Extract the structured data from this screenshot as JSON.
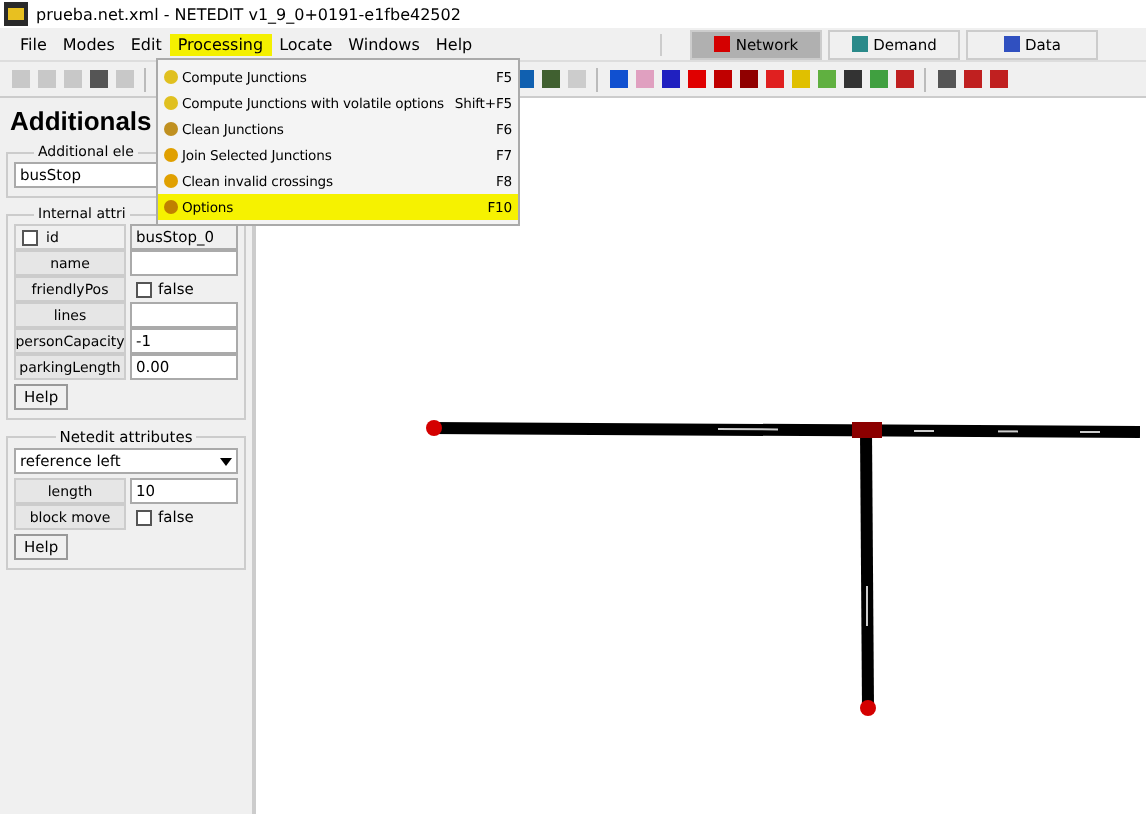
{
  "window": {
    "title": "prueba.net.xml - NETEDIT v1_9_0+0191-e1fbe42502"
  },
  "menubar": [
    {
      "label": "File",
      "selected": false
    },
    {
      "label": "Modes",
      "selected": false
    },
    {
      "label": "Edit",
      "selected": false
    },
    {
      "label": "Processing",
      "selected": true
    },
    {
      "label": "Locate",
      "selected": false
    },
    {
      "label": "Windows",
      "selected": false
    },
    {
      "label": "Help",
      "selected": false
    }
  ],
  "mode_tabs": [
    {
      "label": "Network",
      "selected": true
    },
    {
      "label": "Demand",
      "selected": false
    },
    {
      "label": "Data",
      "selected": false
    }
  ],
  "menu": [
    {
      "label": "Compute Junctions",
      "shortcut": "F5",
      "selected": false
    },
    {
      "label": "Compute Junctions with volatile options",
      "shortcut": "Shift+F5",
      "selected": false
    },
    {
      "label": "Clean Junctions",
      "shortcut": "F6",
      "selected": false
    },
    {
      "label": "Join Selected Junctions",
      "shortcut": "F7",
      "selected": false
    },
    {
      "label": "Clean invalid crossings",
      "shortcut": "F8",
      "selected": false
    },
    {
      "label": "Options",
      "shortcut": "F10",
      "selected": true
    }
  ],
  "panel": {
    "title": "Additionals",
    "element_group": {
      "title": "Additional ele",
      "value": "busStop"
    },
    "internal": {
      "title": "Internal attri",
      "rows": [
        {
          "kind": "check-label",
          "label": "id",
          "checked": false,
          "value": "busStop_0"
        },
        {
          "kind": "text",
          "label": "name"
        },
        {
          "kind": "bool",
          "label": "friendlyPos",
          "checked": false,
          "value": "false"
        },
        {
          "kind": "text",
          "label": "lines"
        },
        {
          "kind": "text",
          "label": "personCapacity",
          "value": "-1"
        },
        {
          "kind": "text",
          "label": "parkingLength",
          "value": "0.00"
        }
      ],
      "help": "Help"
    },
    "netedit": {
      "title": "Netedit attributes",
      "reference": "reference left",
      "rows": [
        {
          "kind": "text",
          "label": "length",
          "value": "10"
        },
        {
          "kind": "bool",
          "label": "block move",
          "checked": false,
          "value": "false"
        }
      ],
      "help": "Help"
    }
  }
}
